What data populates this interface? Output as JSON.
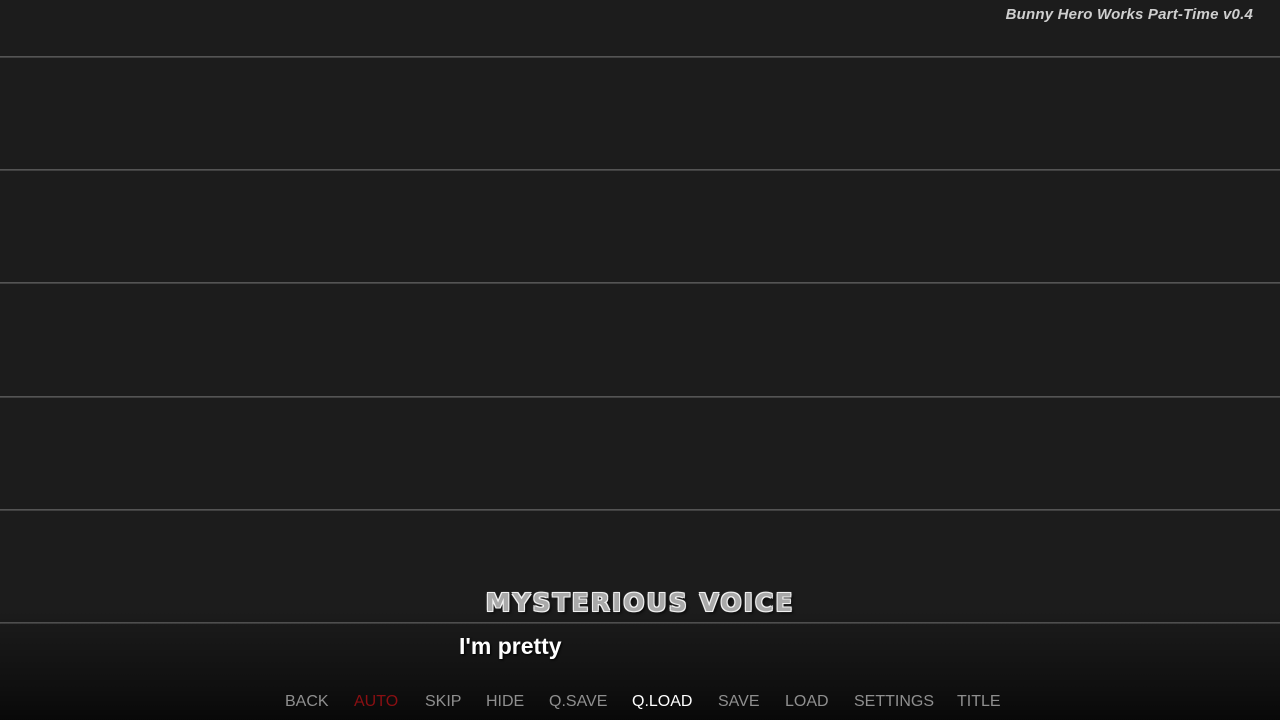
{
  "window": {
    "title": "Bunny Hero Works Part-Time v0.4"
  },
  "dialogue": {
    "speaker": "MYSTERIOUS VOICE",
    "text": "I'm pretty"
  },
  "quick_menu": {
    "items": [
      {
        "label": "BACK",
        "state": "normal"
      },
      {
        "label": "AUTO",
        "state": "active"
      },
      {
        "label": "SKIP",
        "state": "normal"
      },
      {
        "label": "HIDE",
        "state": "normal"
      },
      {
        "label": "Q.SAVE",
        "state": "normal"
      },
      {
        "label": "Q.LOAD",
        "state": "highlight"
      },
      {
        "label": "SAVE",
        "state": "normal"
      },
      {
        "label": "LOAD",
        "state": "normal"
      },
      {
        "label": "SETTINGS",
        "state": "normal"
      },
      {
        "label": "TITLE",
        "state": "normal"
      }
    ]
  },
  "colors": {
    "background": "#1c1c1c",
    "menu_normal": "#8f8f8f",
    "menu_active": "#8a0f12",
    "menu_highlight": "#ffffff",
    "dialogue_text": "#ffffff",
    "speaker_name": "#a9a9a9"
  }
}
